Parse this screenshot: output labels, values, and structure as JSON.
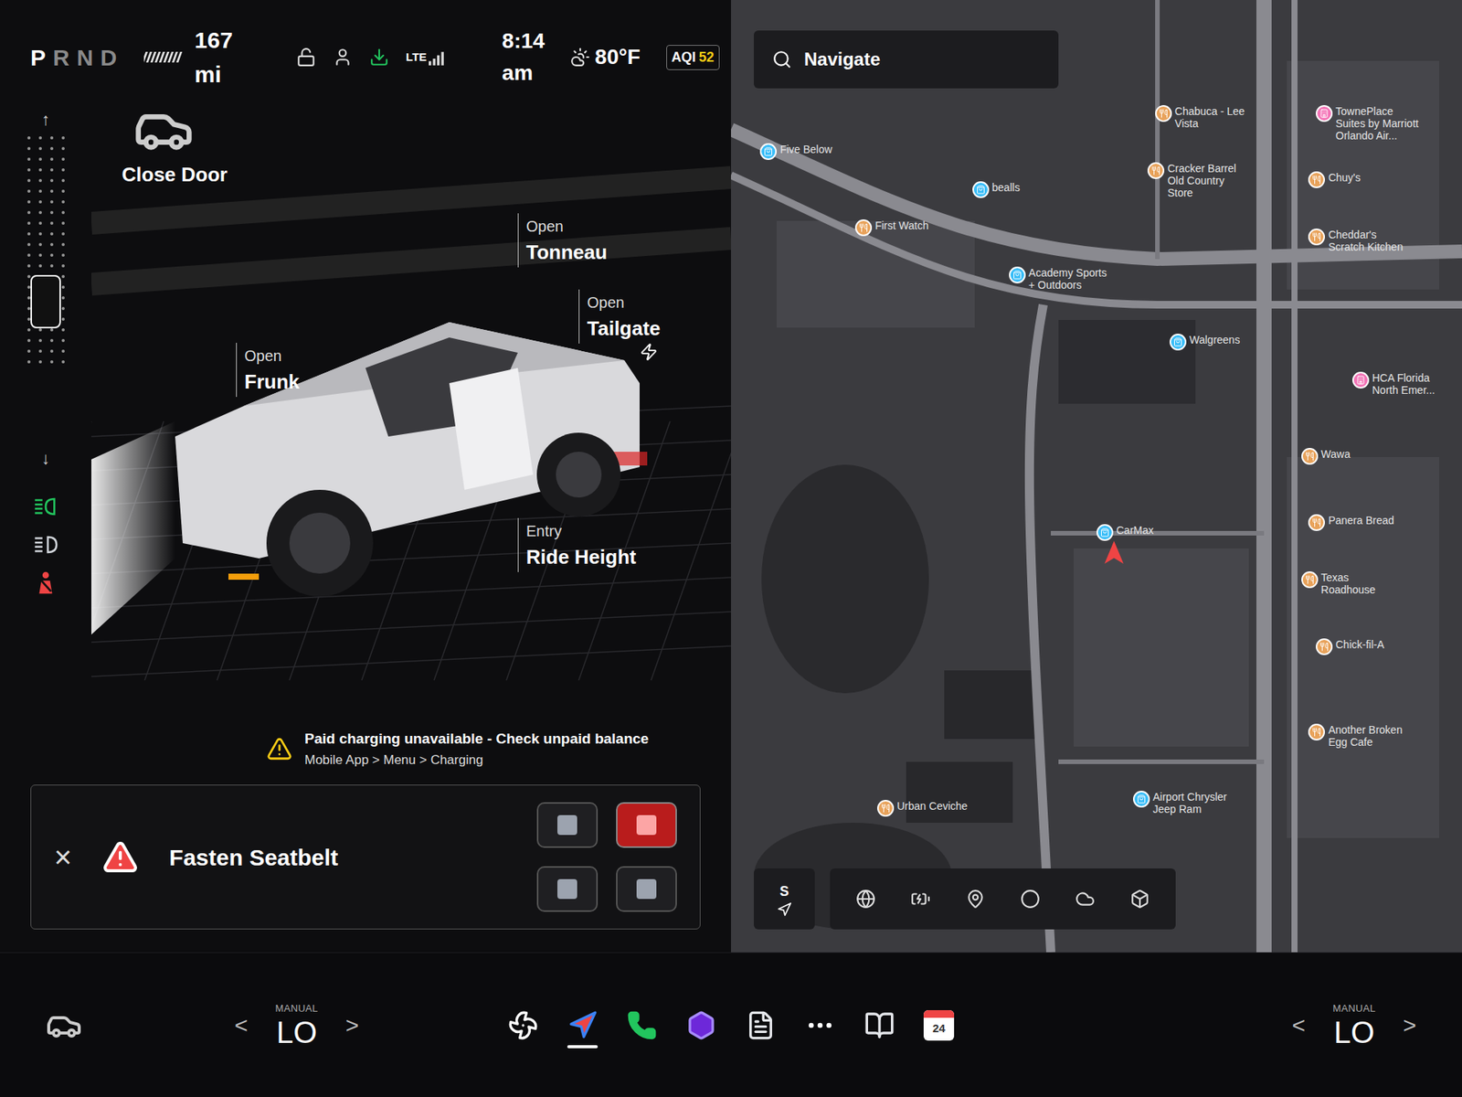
{
  "status": {
    "gears": [
      {
        "label": "P",
        "selected": true
      },
      {
        "label": "R",
        "selected": false
      },
      {
        "label": "N",
        "selected": false
      },
      {
        "label": "D",
        "selected": false
      }
    ],
    "range": "167 mi",
    "network": "LTE",
    "time": "8:14 am",
    "temperature": "80°F",
    "aqi_label": "AQI",
    "aqi_value": "52"
  },
  "ride_height": {
    "up": "↑",
    "down": "↓",
    "level": 0.45
  },
  "indicators": [
    {
      "name": "headlights",
      "color": "#22c55e"
    },
    {
      "name": "auto-high-beam",
      "color": "#d1d5db"
    },
    {
      "name": "seatbelt",
      "color": "#ef4444"
    }
  ],
  "vehicle": {
    "controls": [
      {
        "top": "",
        "label": "Close Door"
      },
      {
        "top": "Open",
        "label": "Tonneau"
      },
      {
        "top": "Open",
        "label": "Tailgate"
      },
      {
        "top": "Open",
        "label": "Frunk"
      },
      {
        "top": "Entry",
        "label": "Ride Height"
      }
    ]
  },
  "warning": {
    "title": "Paid charging unavailable - Check unpaid balance",
    "detail": "Mobile App > Menu > Charging"
  },
  "alert": {
    "close": "×",
    "message": "Fasten Seatbelt"
  },
  "seats": [
    {
      "warning": false
    },
    {
      "warning": true
    },
    {
      "warning": false
    },
    {
      "warning": false
    }
  ],
  "map": {
    "search_placeholder": "Navigate",
    "compass": "S",
    "pois": [
      {
        "name": "Five Below",
        "kind": "shop",
        "color": "#38bdf8",
        "current_location": false
      },
      {
        "name": "bealls",
        "kind": "shop",
        "color": "#38bdf8",
        "current_location": false
      },
      {
        "name": "First Watch",
        "kind": "food",
        "color": "#e8a25a",
        "current_location": false
      },
      {
        "name": "Academy Sports + Outdoors",
        "kind": "shop",
        "color": "#38bdf8",
        "current_location": false
      },
      {
        "name": "Walgreens",
        "kind": "shop",
        "color": "#38bdf8",
        "current_location": false
      },
      {
        "name": "CarMax",
        "kind": "shop",
        "color": "#38bdf8",
        "current_location": true
      },
      {
        "name": "Chabuca - Lee Vista",
        "kind": "food",
        "color": "#e8a25a",
        "current_location": false
      },
      {
        "name": "Cracker Barrel Old Country Store",
        "kind": "food",
        "color": "#e8a25a",
        "current_location": false
      },
      {
        "name": "TownePlace Suites by Marriott Orlando Air...",
        "kind": "hotel",
        "color": "#f472b6",
        "current_location": false
      },
      {
        "name": "Chuy's",
        "kind": "food",
        "color": "#e8a25a",
        "current_location": false
      },
      {
        "name": "Cheddar's Scratch Kitchen",
        "kind": "food",
        "color": "#e8a25a",
        "current_location": false
      },
      {
        "name": "HCA Florida North Emer...",
        "kind": "hotel",
        "color": "#f472b6",
        "current_location": false
      },
      {
        "name": "Wawa",
        "kind": "food",
        "color": "#e8a25a",
        "current_location": false
      },
      {
        "name": "Panera Bread",
        "kind": "food",
        "color": "#e8a25a",
        "current_location": false
      },
      {
        "name": "Texas Roadhouse",
        "kind": "food",
        "color": "#e8a25a",
        "current_location": false
      },
      {
        "name": "Chick-fil-A",
        "kind": "food",
        "color": "#e8a25a",
        "current_location": false
      },
      {
        "name": "Another Broken Egg Cafe",
        "kind": "food",
        "color": "#e8a25a",
        "current_location": false
      },
      {
        "name": "Urban Ceviche",
        "kind": "food",
        "color": "#e8a25a",
        "current_location": false
      },
      {
        "name": "Airport Chrysler Jeep Ram",
        "kind": "shop",
        "color": "#38bdf8",
        "current_location": false
      }
    ]
  },
  "climate": {
    "left": {
      "mode": "MANUAL",
      "setting": "LO",
      "prev": "<",
      "next": ">"
    },
    "right": {
      "mode": "MANUAL",
      "setting": "LO",
      "prev": "<",
      "next": ">"
    }
  },
  "dock": [
    {
      "kind": "climate",
      "selected": false,
      "text": ""
    },
    {
      "kind": "navigation",
      "selected": true,
      "text": ""
    },
    {
      "kind": "phone",
      "selected": false,
      "text": ""
    },
    {
      "kind": "arcade",
      "selected": false,
      "text": ""
    },
    {
      "kind": "notes",
      "selected": false,
      "text": ""
    },
    {
      "kind": "more",
      "selected": false,
      "text": ""
    },
    {
      "kind": "manual",
      "selected": false,
      "text": ""
    },
    {
      "kind": "calendar",
      "selected": false,
      "text": "24"
    }
  ]
}
